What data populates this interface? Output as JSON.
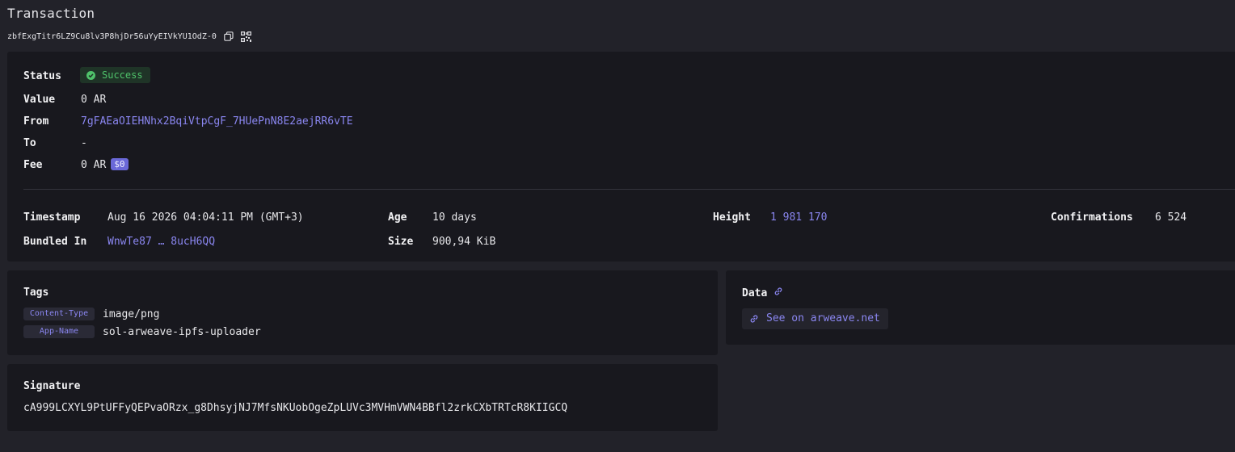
{
  "page": {
    "title": "Transaction",
    "tx_id": "zbfExgTitr6LZ9Cu8lv3P8hjDr56uYyEIVkYU1OdZ-0"
  },
  "overview": {
    "status_label": "Status",
    "status_value": "Success",
    "value_label": "Value",
    "value_value": "0 AR",
    "from_label": "From",
    "from_value": "7gFAEaOIEHNhx2BqiVtpCgF_7HUePnN8E2aejRR6vTE",
    "to_label": "To",
    "to_value": "-",
    "fee_label": "Fee",
    "fee_value": "0 AR",
    "fee_usd": "$0"
  },
  "details": {
    "timestamp_label": "Timestamp",
    "timestamp_value": "Aug 16 2026 04:04:11 PM (GMT+3)",
    "bundled_label": "Bundled In",
    "bundled_value": "WnwTe87 … 8ucH6QQ",
    "age_label": "Age",
    "age_value": "10 days",
    "size_label": "Size",
    "size_value": "900,94 KiB",
    "height_label": "Height",
    "height_value": "1 981 170",
    "confirmations_label": "Confirmations",
    "confirmations_value": "6 524"
  },
  "tags": {
    "title": "Tags",
    "items": [
      {
        "key": "Content-Type",
        "value": "image/png"
      },
      {
        "key": "App-Name",
        "value": "sol-arweave-ipfs-uploader"
      }
    ]
  },
  "data_section": {
    "title": "Data",
    "link_label": "See on arweave.net"
  },
  "signature": {
    "title": "Signature",
    "value": "cA999LCXYL9PtUFFyQEPvaORzx_g8DhsyjNJ7MfsNKUobOgeZpLUVc3MVHmVWN4BBfl2zrkCXbTRTcR8KIIGCQ"
  },
  "icons": {
    "copy": "copy-icon",
    "qr": "qr-code-icon",
    "success": "check-circle-icon",
    "link": "link-icon"
  },
  "colors": {
    "accent": "#8a86f0",
    "success": "#4fc26a",
    "background": "#222229",
    "card": "#18181e"
  }
}
